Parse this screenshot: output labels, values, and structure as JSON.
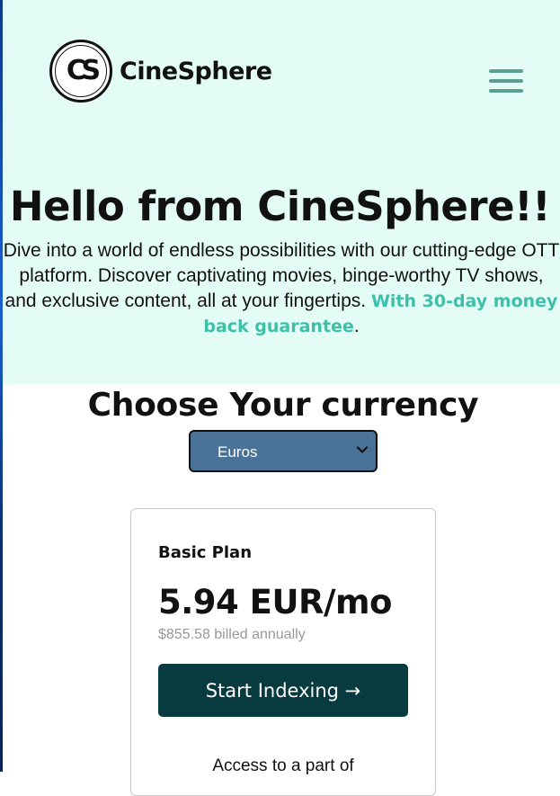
{
  "brand": {
    "mark": "CS",
    "name": "CineSphere"
  },
  "hero": {
    "title": "Hello from CineSphere!!",
    "text": "Dive into a world of endless possibilities with our cutting-edge OTT platform. Discover captivating movies, binge-worthy TV shows, and exclusive content, all at your fingertips.",
    "highlight": "With 30-day money back guarantee",
    "end": "."
  },
  "currency": {
    "title": "Choose Your currency",
    "selected": "Euros"
  },
  "plan": {
    "name": "Basic Plan",
    "price": "5.94 EUR/mo",
    "billed": "$855.58 billed annually",
    "cta": "Start Indexing →",
    "feature": "Access to a part of"
  },
  "colors": {
    "hero_bg": "#e3fcf6",
    "accent": "#3ebfa8",
    "select_bg": "#4a7297",
    "cta_bg": "#073b3f",
    "menu_icon": "#5a9e96"
  },
  "icons": {
    "menu": "hamburger-menu-icon",
    "select": "chevron-down-icon"
  }
}
